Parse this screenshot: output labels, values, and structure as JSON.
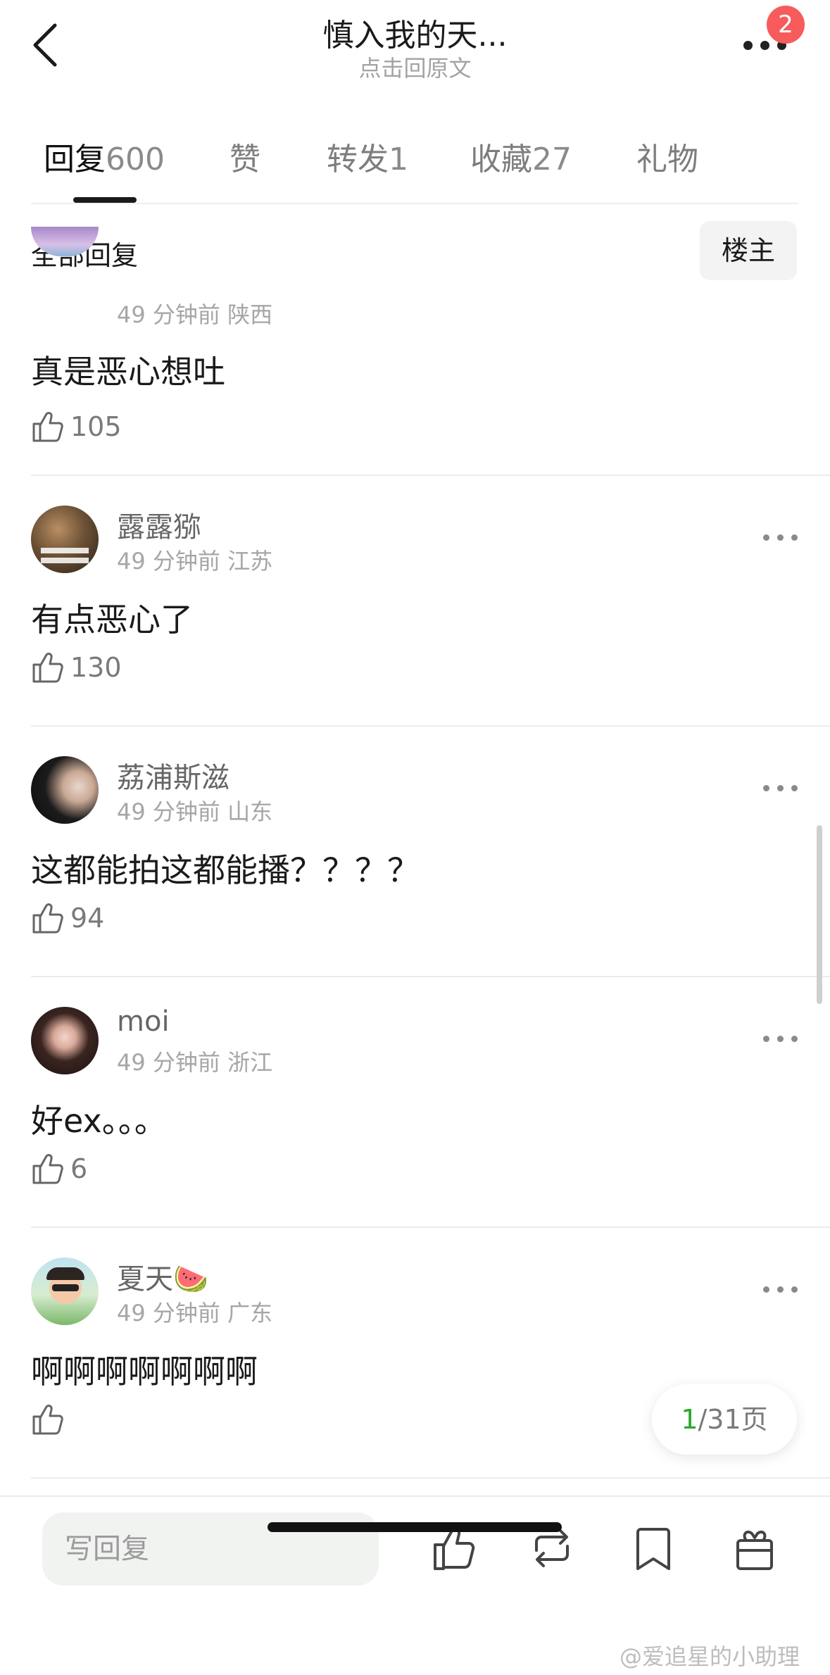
{
  "header": {
    "title": "慎入我的天...",
    "subtitle": "点击回原文",
    "notification_count": "2"
  },
  "tabs": [
    {
      "label": "回复",
      "count": "600",
      "active": true
    },
    {
      "label": "赞",
      "count": "",
      "active": false
    },
    {
      "label": "转发",
      "count": "1",
      "active": false
    },
    {
      "label": "收藏",
      "count": "27",
      "active": false
    },
    {
      "label": "礼物",
      "count": "",
      "active": false
    }
  ],
  "filter": {
    "label": "全部回复",
    "owner_button": "楼主"
  },
  "comments": [
    {
      "name": "",
      "time": "49 分钟前",
      "location": "陕西",
      "text": "真是恶心想吐",
      "likes": "105"
    },
    {
      "name": "露露猕",
      "time": "49 分钟前",
      "location": "江苏",
      "text": "有点恶心了",
      "likes": "130"
    },
    {
      "name": "荔浦斯滋",
      "time": "49 分钟前",
      "location": "山东",
      "text": "这都能拍这都能播？？？？",
      "likes": "94"
    },
    {
      "name": "moi",
      "time": "49 分钟前",
      "location": "浙江",
      "text": "好ex。。。",
      "likes": "6"
    },
    {
      "name": "夏天🍉",
      "time": "49 分钟前",
      "location": "广东",
      "text": "啊啊啊啊啊啊啊",
      "likes": ""
    }
  ],
  "pagination": {
    "current": "1",
    "rest": "/31页"
  },
  "bottom_bar": {
    "reply_placeholder": "写回复"
  },
  "watermark": "@爱追星的小助理",
  "icons": {
    "back": "back-arrow-icon",
    "more": "more-dots-icon",
    "like": "thumbs-up-icon",
    "repost": "repost-icon",
    "bookmark": "bookmark-icon",
    "gift": "gift-icon"
  },
  "colors": {
    "badge": "#f75b5b",
    "page_current": "#2aa82a",
    "input_bg": "#f1f3f1"
  }
}
